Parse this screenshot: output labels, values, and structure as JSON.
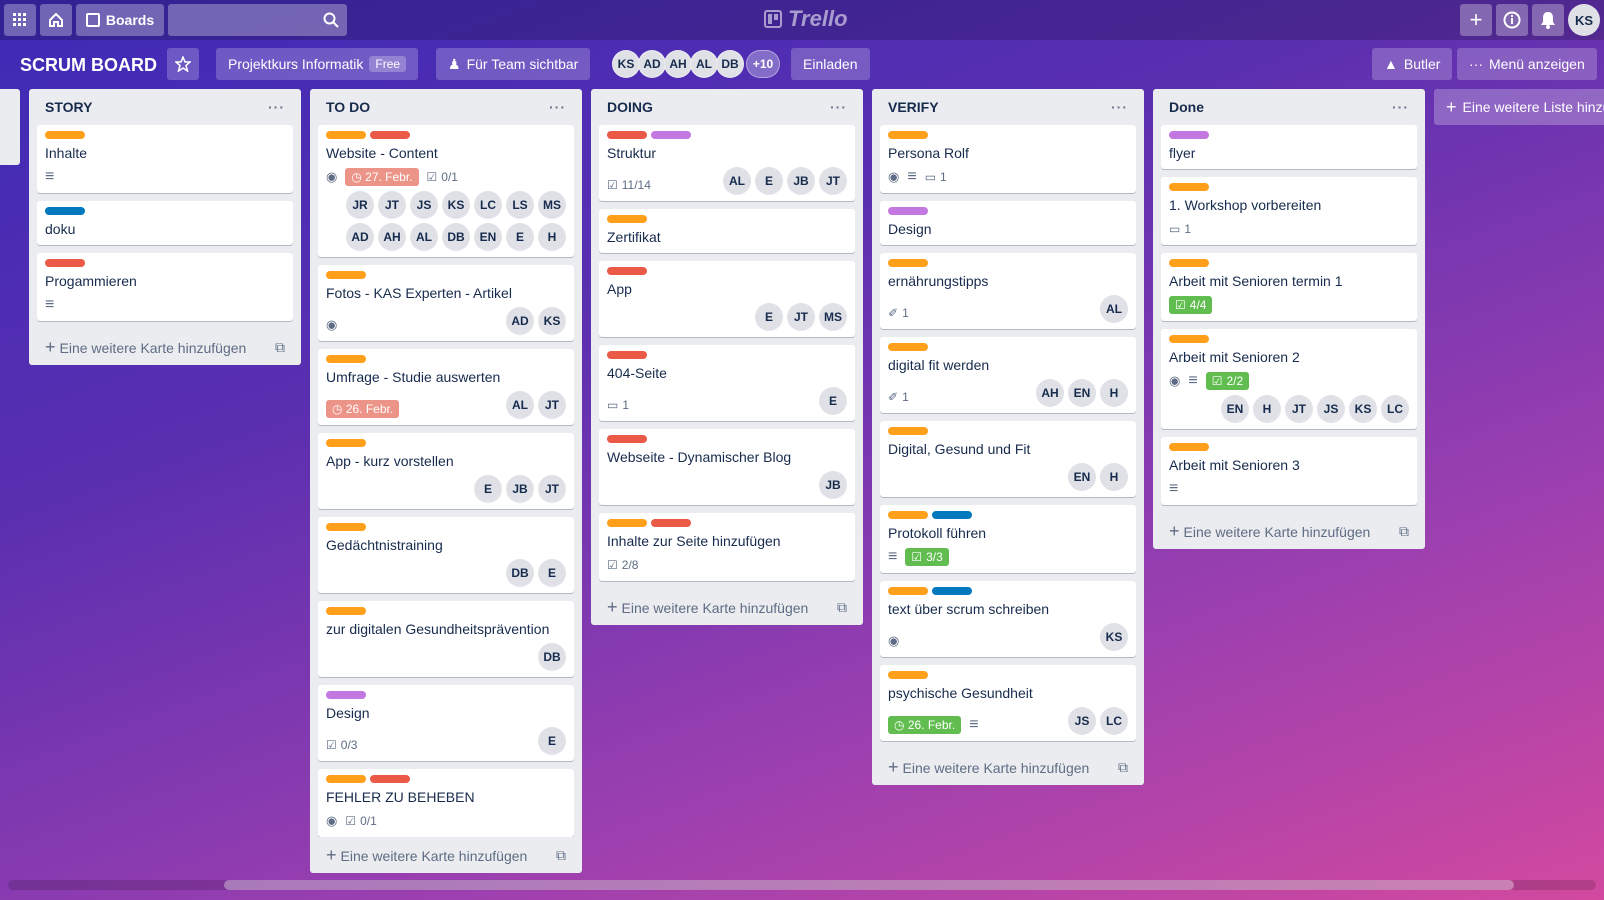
{
  "topbar": {
    "boards_label": "Boards",
    "logo_text": "Trello",
    "user_initials": "KS"
  },
  "board": {
    "title": "SCRUM BOARD",
    "team": "Projektkurs Informatik",
    "team_badge": "Free",
    "visibility": "Für Team sichtbar",
    "members": [
      "KS",
      "AD",
      "AH",
      "AL",
      "DB"
    ],
    "members_more": "+10",
    "invite": "Einladen",
    "butler": "Butler",
    "menu": "Menü anzeigen",
    "add_list": "Eine weitere Liste hinzufügen"
  },
  "colors": {
    "orange": "#ff9f1a",
    "red": "#eb5a46",
    "purple": "#c377e0",
    "blue": "#0079bf"
  },
  "add_card_label": "Eine weitere Karte hinzufügen",
  "lists": [
    {
      "name": "STORY",
      "cards": [
        {
          "labels": [
            "orange"
          ],
          "title": "Inhalte",
          "desc": true
        },
        {
          "labels": [
            "blue"
          ],
          "title": "doku"
        },
        {
          "labels": [
            "red"
          ],
          "title": "Progammieren",
          "desc": true
        }
      ]
    },
    {
      "name": "TO DO",
      "cards": [
        {
          "labels": [
            "orange",
            "red"
          ],
          "title": "Website - Content",
          "watch": true,
          "due": "27. Febr.",
          "due_style": "red",
          "checklist": "0/1",
          "members": [
            "JR",
            "JT",
            "JS",
            "KS",
            "LC",
            "LS",
            "MS",
            "AD",
            "AH",
            "AL",
            "DB",
            "EN",
            "E",
            "H"
          ]
        },
        {
          "labels": [
            "orange"
          ],
          "title": "Fotos - KAS Experten - Artikel",
          "watch": true,
          "members": [
            "AD",
            "KS"
          ]
        },
        {
          "labels": [
            "orange"
          ],
          "title": "Umfrage - Studie auswerten",
          "due": "26. Febr.",
          "due_style": "red",
          "members": [
            "AL",
            "JT"
          ]
        },
        {
          "labels": [
            "orange"
          ],
          "title": "App - kurz vorstellen",
          "members": [
            "E",
            "JB",
            "JT"
          ]
        },
        {
          "labels": [
            "orange"
          ],
          "title": "Gedächtnistraining",
          "members": [
            "DB",
            "E"
          ]
        },
        {
          "labels": [
            "orange"
          ],
          "title": "zur digitalen Gesundheitsprävention",
          "members": [
            "DB"
          ]
        },
        {
          "labels": [
            "purple"
          ],
          "title": "Design",
          "checklist": "0/3",
          "members": [
            "E"
          ]
        },
        {
          "labels": [
            "orange",
            "red"
          ],
          "title": "FEHLER ZU BEHEBEN",
          "watch": true,
          "checklist": "0/1"
        }
      ]
    },
    {
      "name": "DOING",
      "cards": [
        {
          "labels": [
            "red",
            "purple"
          ],
          "title": "Struktur",
          "checklist": "11/14",
          "members": [
            "AL",
            "E",
            "JB",
            "JT"
          ]
        },
        {
          "labels": [
            "orange"
          ],
          "title": "Zertifikat"
        },
        {
          "labels": [
            "red"
          ],
          "title": "App",
          "members": [
            "E",
            "JT",
            "MS"
          ]
        },
        {
          "labels": [
            "red"
          ],
          "title": "404-Seite",
          "comments": "1",
          "members": [
            "E"
          ]
        },
        {
          "labels": [
            "red"
          ],
          "title": "Webseite - Dynamischer Blog",
          "members": [
            "JB"
          ]
        },
        {
          "labels": [
            "orange",
            "red"
          ],
          "title": "Inhalte zur Seite hinzufügen",
          "checklist": "2/8"
        }
      ]
    },
    {
      "name": "VERIFY",
      "cards": [
        {
          "labels": [
            "orange"
          ],
          "title": "Persona Rolf",
          "watch": true,
          "desc": true,
          "comments": "1"
        },
        {
          "labels": [
            "purple"
          ],
          "title": "Design"
        },
        {
          "labels": [
            "orange"
          ],
          "title": "ernährungstipps",
          "attachments": "1",
          "members": [
            "AL"
          ]
        },
        {
          "labels": [
            "orange"
          ],
          "title": "digital fit werden",
          "attachments": "1",
          "members": [
            "AH",
            "EN",
            "H"
          ]
        },
        {
          "labels": [
            "orange"
          ],
          "title": "Digital, Gesund und Fit",
          "members": [
            "EN",
            "H"
          ]
        },
        {
          "labels": [
            "orange",
            "blue"
          ],
          "title": "Protokoll führen",
          "desc": true,
          "checklist": "3/3",
          "checklist_done": true
        },
        {
          "labels": [
            "orange",
            "blue"
          ],
          "title": "text über scrum schreiben",
          "watch": true,
          "members": [
            "KS"
          ]
        },
        {
          "labels": [
            "orange"
          ],
          "title": "psychische Gesundheit",
          "due": "26. Febr.",
          "due_style": "green",
          "desc": true,
          "members": [
            "JS",
            "LC"
          ]
        }
      ]
    },
    {
      "name": "Done",
      "cards": [
        {
          "labels": [
            "purple"
          ],
          "title": "flyer"
        },
        {
          "labels": [
            "orange"
          ],
          "title": "1. Workshop vorbereiten",
          "comments": "1"
        },
        {
          "labels": [
            "orange"
          ],
          "title": "Arbeit mit Senioren termin 1",
          "checklist": "4/4",
          "checklist_done": true
        },
        {
          "labels": [
            "orange"
          ],
          "title": "Arbeit mit Senioren 2",
          "watch": true,
          "desc": true,
          "checklist": "2/2",
          "checklist_done": true,
          "members": [
            "EN",
            "H",
            "JT",
            "JS",
            "KS",
            "LC"
          ]
        },
        {
          "labels": [
            "orange"
          ],
          "title": "Arbeit mit Senioren 3",
          "desc": true
        }
      ]
    }
  ]
}
